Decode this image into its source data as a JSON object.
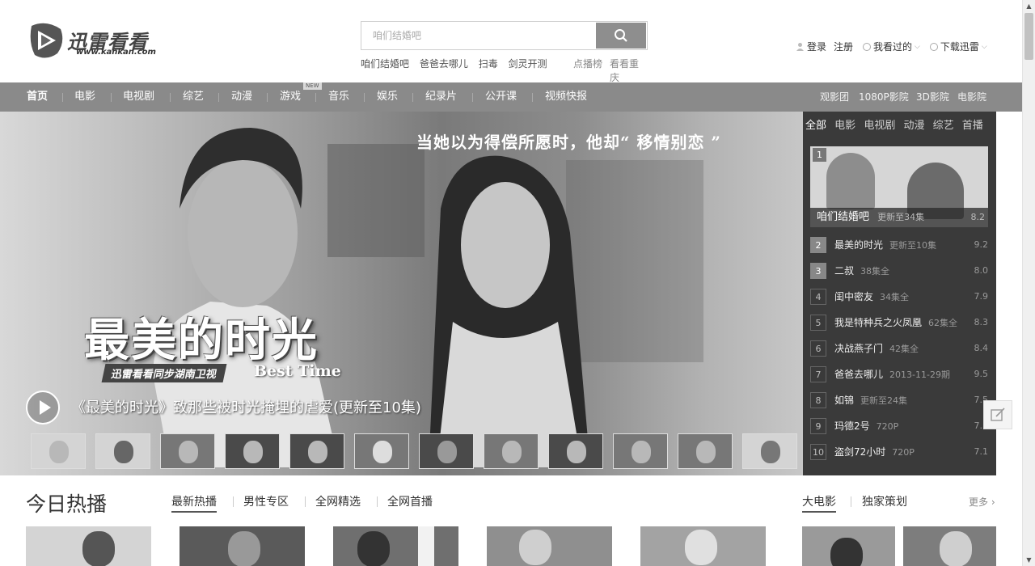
{
  "logo": {
    "name": "迅雷看看",
    "url": "www.kankan.com"
  },
  "search": {
    "placeholder": "咱们结婚吧"
  },
  "hotwords": [
    "咱们结婚吧",
    "爸爸去哪儿",
    "扫毒",
    "剑灵开测"
  ],
  "hotlinks": [
    "点播榜",
    "看看重庆"
  ],
  "userbar": {
    "login": "登录",
    "register": "注册",
    "history": "我看过的",
    "download": "下载迅雷"
  },
  "nav": {
    "items": [
      "首页",
      "电影",
      "电视剧",
      "综艺",
      "动漫",
      "游戏",
      "音乐",
      "娱乐",
      "纪录片",
      "公开课",
      "视频快报"
    ],
    "badge": "NEW",
    "right": [
      "观影团",
      "1080P影院",
      "3D影院",
      "电影院"
    ]
  },
  "banner": {
    "tagline": "当她以为得偿所愿时，他却“ 移情别恋 ”",
    "title": "最美的时光",
    "sub": "迅雷看看同步湖南卫视",
    "english": "Best Time",
    "caption": "《最美的时光》致那些被时光掩埋的虐爱(更新至10集)"
  },
  "rank": {
    "tabs": [
      "全部",
      "电影",
      "电视剧",
      "动漫",
      "综艺",
      "首播"
    ],
    "items": [
      {
        "n": "1",
        "title": "咱们结婚吧",
        "update": "更新至34集",
        "score": "8.2"
      },
      {
        "n": "2",
        "title": "最美的时光",
        "update": "更新至10集",
        "score": "9.2"
      },
      {
        "n": "3",
        "title": "二叔",
        "update": "38集全",
        "score": "8.0"
      },
      {
        "n": "4",
        "title": "闺中密友",
        "update": "34集全",
        "score": "7.9"
      },
      {
        "n": "5",
        "title": "我是特种兵之火凤凰",
        "update": "62集全",
        "score": "8.3"
      },
      {
        "n": "6",
        "title": "决战燕子门",
        "update": "42集全",
        "score": "8.4"
      },
      {
        "n": "7",
        "title": "爸爸去哪儿",
        "update": "2013-11-29期",
        "score": "9.5"
      },
      {
        "n": "8",
        "title": "如锦",
        "update": "更新至24集",
        "score": "7.5"
      },
      {
        "n": "9",
        "title": "玛德2号",
        "update": "720P",
        "score": "7.3"
      },
      {
        "n": "10",
        "title": "盗剑72小时",
        "update": "720P",
        "score": "7.1"
      }
    ]
  },
  "today": {
    "title": "今日热播",
    "tabs": [
      "最新热播",
      "男性专区",
      "全网精选",
      "全网首播"
    ],
    "right_tabs": [
      "大电影",
      "独家策划"
    ],
    "more": "更多"
  }
}
